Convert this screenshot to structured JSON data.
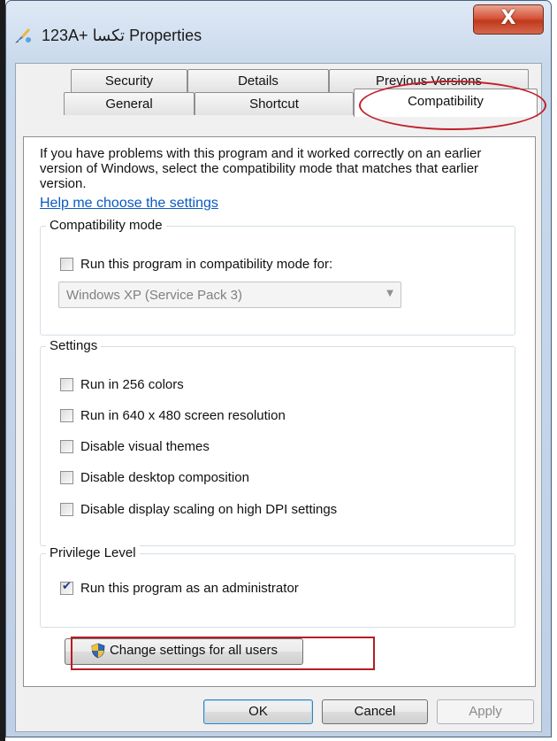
{
  "window": {
    "title": "123A+ تكسا Properties",
    "close_label": "X"
  },
  "tabs": {
    "row1": [
      {
        "label": "Security"
      },
      {
        "label": "Details"
      },
      {
        "label": "Previous Versions"
      }
    ],
    "row2": [
      {
        "label": "General"
      },
      {
        "label": "Shortcut"
      },
      {
        "label": "Compatibility",
        "active": true
      }
    ]
  },
  "intro": {
    "text": "If you have problems with this program and it worked correctly on an earlier version of Windows, select the compatibility mode that matches that earlier version.",
    "help_link": "Help me choose the settings"
  },
  "compat_mode": {
    "legend": "Compatibility mode",
    "checkbox": {
      "label": "Run this program in compatibility mode for:",
      "checked": false
    },
    "select": {
      "value": "Windows XP (Service Pack 3)",
      "disabled": true
    }
  },
  "settings": {
    "legend": "Settings",
    "items": [
      {
        "label": "Run in 256 colors",
        "checked": false
      },
      {
        "label": "Run in 640 x 480 screen resolution",
        "checked": false
      },
      {
        "label": "Disable visual themes",
        "checked": false
      },
      {
        "label": "Disable desktop composition",
        "checked": false
      },
      {
        "label": "Disable display scaling on high DPI settings",
        "checked": false
      }
    ]
  },
  "privilege": {
    "legend": "Privilege Level",
    "checkbox": {
      "label": "Run this program as an administrator",
      "checked": true
    }
  },
  "change_all_button": {
    "label": "Change settings for all users",
    "icon": "uac-shield-icon"
  },
  "footer": {
    "ok": "OK",
    "cancel": "Cancel",
    "apply": "Apply"
  },
  "colors": {
    "link": "#0a5ac2",
    "highlight_annotation": "#c0202a",
    "close_button": "#c0391c"
  }
}
